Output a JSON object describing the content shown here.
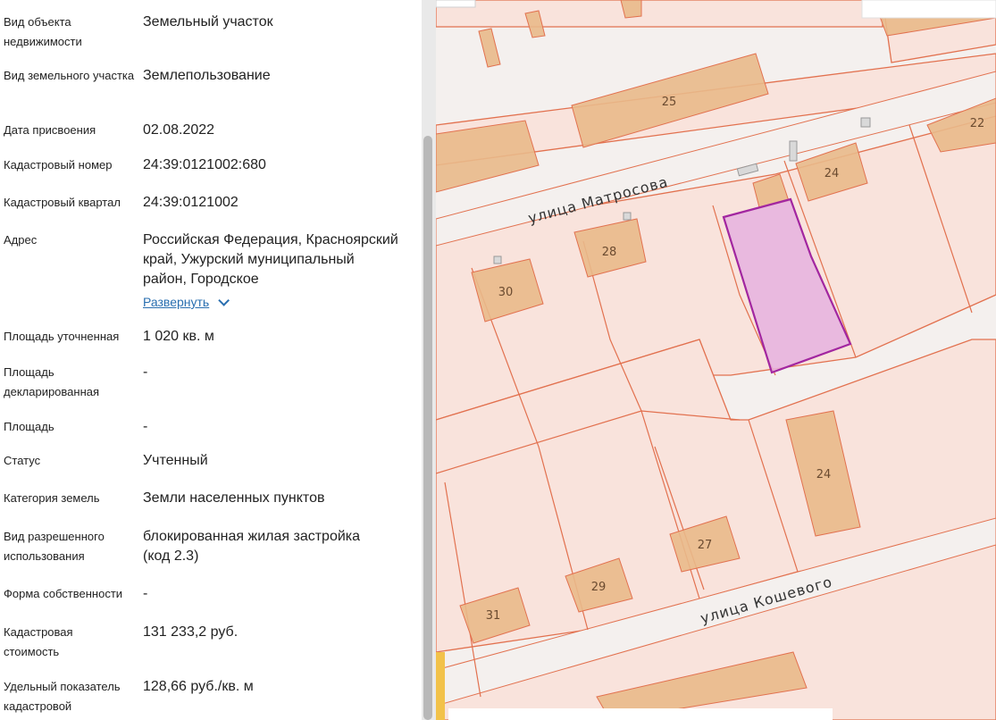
{
  "details": [
    {
      "label": "Вид объекта недвижимости",
      "value": "Земельный участок"
    },
    {
      "label": "Вид земельного участка",
      "value": "Землепользование"
    },
    {
      "label": "Дата присвоения",
      "value": "02.08.2022"
    },
    {
      "label": "Кадастровый номер",
      "value": "24:39:0121002:680"
    },
    {
      "label": "Кадастровый квартал",
      "value": "24:39:0121002"
    },
    {
      "label": "Адрес",
      "value": "Российская Федерация, Красноярский край, Ужурский муниципальный район, Городское"
    },
    {
      "label": "Площадь уточненная",
      "value": "1 020 кв. м"
    },
    {
      "label": "Площадь декларированная",
      "value": "-"
    },
    {
      "label": "Площадь",
      "value": "-"
    },
    {
      "label": "Статус",
      "value": "Учтенный"
    },
    {
      "label": "Категория земель",
      "value": "Земли населенных пунктов"
    },
    {
      "label": "Вид разрешенного использования",
      "value": "блокированная жилая застройка (код 2.3)"
    },
    {
      "label": "Форма собственности",
      "value": "-"
    },
    {
      "label": "Кадастровая стоимость",
      "value": "131 233,2 руб."
    },
    {
      "label": "Удельный показатель кадастровой",
      "value": "128,66 руб./кв. м"
    }
  ],
  "address_expand": "Развернуть",
  "map": {
    "streets": [
      "улица Матросова",
      "улица Кошевого"
    ],
    "building_numbers": [
      "25",
      "22",
      "24",
      "28",
      "30",
      "24",
      "27",
      "29",
      "31"
    ],
    "colors": {
      "parcel_fill": "#f9e3dc",
      "parcel_stroke": "#e2714f",
      "building": "#e9b98a",
      "selected_fill": "#e6b2df",
      "selected_stroke": "#a226a0",
      "road": "#f4f0ee"
    }
  }
}
